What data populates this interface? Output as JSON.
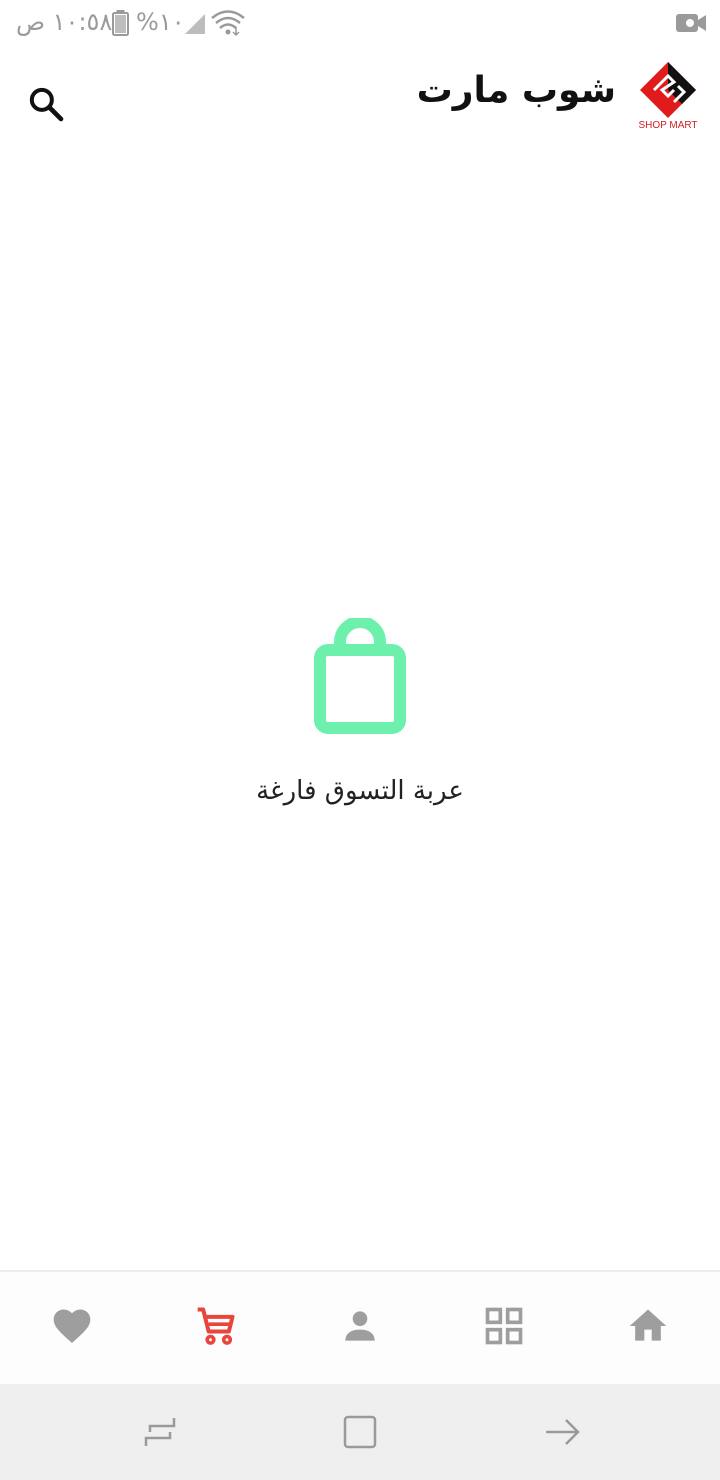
{
  "status_bar": {
    "time": "١٠:٥٨ ص",
    "battery": "%١٠"
  },
  "app_bar": {
    "title": "شوب مارت",
    "logo_text": "SHOP MART"
  },
  "empty_cart": {
    "message": "عربة التسوق فارغة",
    "icon": "shopping-bag-icon",
    "icon_color": "#6ef0ad"
  },
  "bottom_nav": {
    "items": [
      {
        "name": "favorites",
        "icon": "heart-icon",
        "active": false
      },
      {
        "name": "cart",
        "icon": "cart-icon",
        "active": true
      },
      {
        "name": "account",
        "icon": "person-icon",
        "active": false
      },
      {
        "name": "categories",
        "icon": "grid-icon",
        "active": false
      },
      {
        "name": "home",
        "icon": "home-icon",
        "active": false
      }
    ],
    "active_color": "#e8453c",
    "inactive_color": "#9e9e9e"
  },
  "system_nav": {
    "buttons": [
      "recent-apps-icon",
      "home-square-icon",
      "back-arrow-icon"
    ]
  }
}
